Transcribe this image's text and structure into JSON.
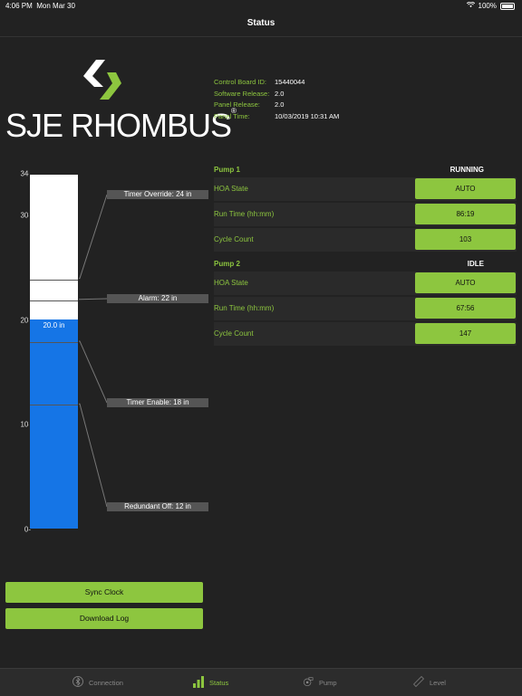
{
  "status_bar": {
    "time": "4:06 PM",
    "date": "Mon Mar 30",
    "battery": "100%"
  },
  "nav": {
    "title": "Status"
  },
  "logo": {
    "text": "SJE RHOMBUS",
    "registered": "®"
  },
  "info": {
    "rows": [
      {
        "label": "Control Board ID:",
        "value": "15440044"
      },
      {
        "label": "Software Release:",
        "value": "2.0"
      },
      {
        "label": "Panel Release:",
        "value": "2.0"
      },
      {
        "label": "Panel Time:",
        "value": "10/03/2019 10:31 AM"
      }
    ]
  },
  "gauge": {
    "ticks": [
      "34-",
      "30-",
      "20-",
      "10-",
      "0-"
    ],
    "tick_values": [
      34,
      30,
      20,
      10,
      0
    ],
    "max": 34,
    "level": 20.0,
    "level_label": "20.0 in",
    "thresholds": [
      {
        "label": "Timer Override: 24 in",
        "value": 24
      },
      {
        "label": "Alarm: 22 in",
        "value": 22
      },
      {
        "label": "Timer Enable: 18 in",
        "value": 18
      },
      {
        "label": "Redundant Off: 12 in",
        "value": 12
      }
    ]
  },
  "pumps": [
    {
      "name": "Pump 1",
      "state": "RUNNING",
      "rows": [
        {
          "label": "HOA State",
          "value": "AUTO"
        },
        {
          "label": "Run Time (hh:mm)",
          "value": "86:19"
        },
        {
          "label": "Cycle Count",
          "value": "103"
        }
      ]
    },
    {
      "name": "Pump 2",
      "state": "IDLE",
      "rows": [
        {
          "label": "HOA State",
          "value": "AUTO"
        },
        {
          "label": "Run Time (hh:mm)",
          "value": "67:56"
        },
        {
          "label": "Cycle Count",
          "value": "147"
        }
      ]
    }
  ],
  "buttons": {
    "sync_clock": "Sync Clock",
    "download_log": "Download Log"
  },
  "tabs": [
    {
      "label": "Connection",
      "icon": "bluetooth-icon",
      "active": false
    },
    {
      "label": "Status",
      "icon": "bar-chart-icon",
      "active": true
    },
    {
      "label": "Pump",
      "icon": "pump-icon",
      "active": false
    },
    {
      "label": "Level",
      "icon": "ruler-icon",
      "active": false
    }
  ],
  "colors": {
    "accent": "#8dc63f",
    "fill": "#1575e6",
    "background": "#222222"
  }
}
